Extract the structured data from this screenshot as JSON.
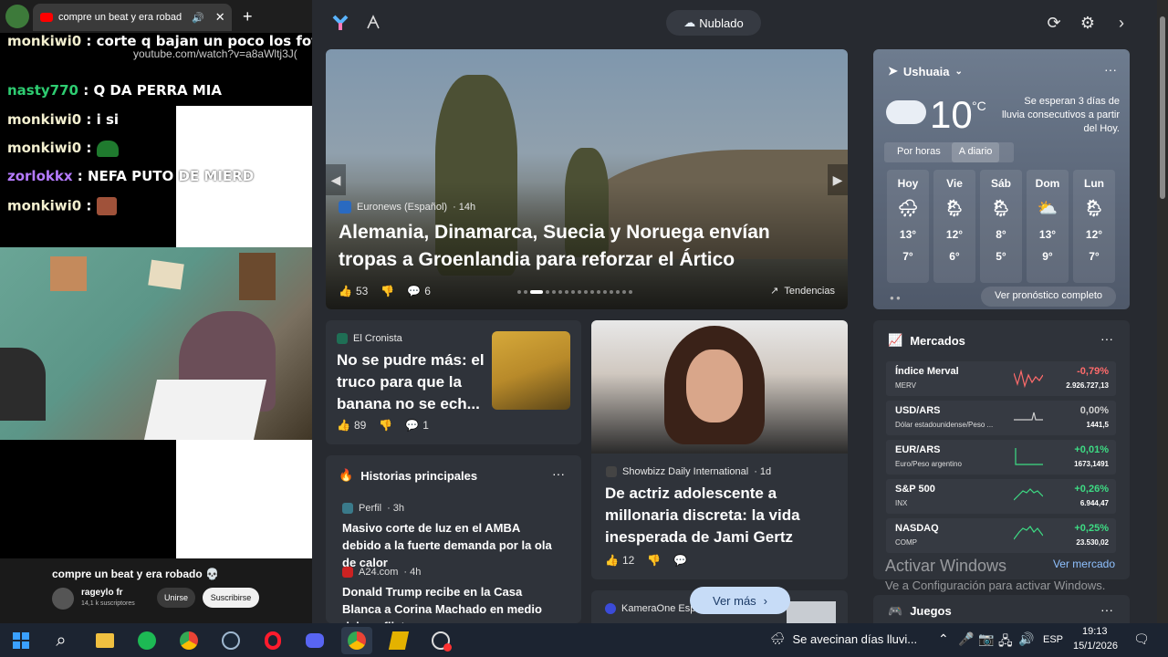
{
  "stream": {
    "tab_title": "compre un beat y era robad",
    "new_tab": "+",
    "url": "youtube.com/watch?v=a8aWltj3J(",
    "chat": [
      {
        "user": "monkiwi0",
        "msg": " : corte q bajan un poco los fotogramas",
        "color": "#f4f0d0"
      },
      {
        "user": "nasty770",
        "msg": " : Q DA PERRA MIA",
        "color": "#2ecc71"
      },
      {
        "user": "monkiwi0",
        "msg": " : i si",
        "color": "#f4f0d0"
      },
      {
        "user": "monkiwi0",
        "msg": " :",
        "color": "#f4f0d0"
      },
      {
        "user": "zorlokkx",
        "msg": " : NEFA PUTO DE MIERD",
        "color": "#b57bff"
      },
      {
        "user": "monkiwi0",
        "msg": " :",
        "color": "#f4f0d0"
      }
    ],
    "video_title": "compre un beat y era robado 💀",
    "channel": "rageylo fr",
    "subscribers": "14,1 k suscriptores",
    "join_label": "Unirse",
    "subscribe_label": "Suscribirse"
  },
  "topbar": {
    "weather_label": "Nublado",
    "refresh_icon": "refresh-icon",
    "settings_icon": "gear-icon"
  },
  "hero": {
    "source": "Euronews (Español)",
    "age": "· 14h",
    "title": "Alemania, Dinamarca, Suecia y Noruega envían tropas a Groenlandia para reforzar el Ártico",
    "likes": "53",
    "comments": "6",
    "trending_label": "Tendencias"
  },
  "weather": {
    "location": "Ushuaia",
    "temp": "10",
    "unit": "°C",
    "alert": "Se esperan 3 días de lluvia consecutivos a partir del Hoy.",
    "tab_hourly": "Por horas",
    "tab_daily": "A diario",
    "days": [
      {
        "name": "Hoy",
        "hi": "13°",
        "lo": "7°",
        "icon": "rain-cloud-icon"
      },
      {
        "name": "Vie",
        "hi": "12°",
        "lo": "6°",
        "icon": "sun-rain-icon"
      },
      {
        "name": "Sáb",
        "hi": "8°",
        "lo": "5°",
        "icon": "sun-rain-icon"
      },
      {
        "name": "Dom",
        "hi": "13°",
        "lo": "9°",
        "icon": "partly-cloudy-icon"
      },
      {
        "name": "Lun",
        "hi": "12°",
        "lo": "7°",
        "icon": "sun-rain-icon"
      }
    ],
    "full_forecast": "Ver pronóstico completo"
  },
  "card_banana": {
    "source": "El Cronista",
    "title": "No se pudre más: el truco para que la banana no se ech...",
    "likes": "89",
    "comments": "1"
  },
  "card_actress": {
    "source": "Showbizz Daily International",
    "age": "· 1d",
    "title": "De actriz adolescente a millonaria discreta: la vida inesperada de Jami Gertz",
    "likes": "12"
  },
  "top_stories": {
    "header": "Historias principales",
    "items": [
      {
        "source": "Perfil",
        "age": "· 3h",
        "title": "Masivo corte de luz en el AMBA debido a la fuerte demanda por la ola de calor"
      },
      {
        "source": "A24.com",
        "age": "· 4h",
        "title": "Donald Trump recibe en la Casa Blanca a Corina Machado en medio del conflict..."
      }
    ]
  },
  "kamera": {
    "source": "KameraOne Esp"
  },
  "see_more": "Ver más",
  "markets": {
    "header": "Mercados",
    "rows": [
      {
        "name": "Índice Merval",
        "sub": "MERV",
        "change": "-0,79%",
        "value": "2.926.727,13",
        "color": "#ff6b6b"
      },
      {
        "name": "USD/ARS",
        "sub": "Dólar estadounidense/Peso ...",
        "change": "0,00%",
        "value": "1441,5",
        "color": "#cfcfcf"
      },
      {
        "name": "EUR/ARS",
        "sub": "Euro/Peso argentino",
        "change": "+0,01%",
        "value": "1673,1491",
        "color": "#3ddc84"
      },
      {
        "name": "S&P 500",
        "sub": "INX",
        "change": "+0,26%",
        "value": "6.944,47",
        "color": "#3ddc84"
      },
      {
        "name": "NASDAQ",
        "sub": "COMP",
        "change": "+0,25%",
        "value": "23.530,02",
        "color": "#3ddc84"
      }
    ],
    "see_market": "Ver mercado"
  },
  "activate": {
    "title": "Activar Windows",
    "subtitle": "Ve a Configuración para activar Windows."
  },
  "games_header": "Juegos",
  "taskbar": {
    "weather_text": "Se avecinan días lluvi...",
    "lang": "ESP",
    "time": "19:13",
    "date": "15/1/2026"
  }
}
